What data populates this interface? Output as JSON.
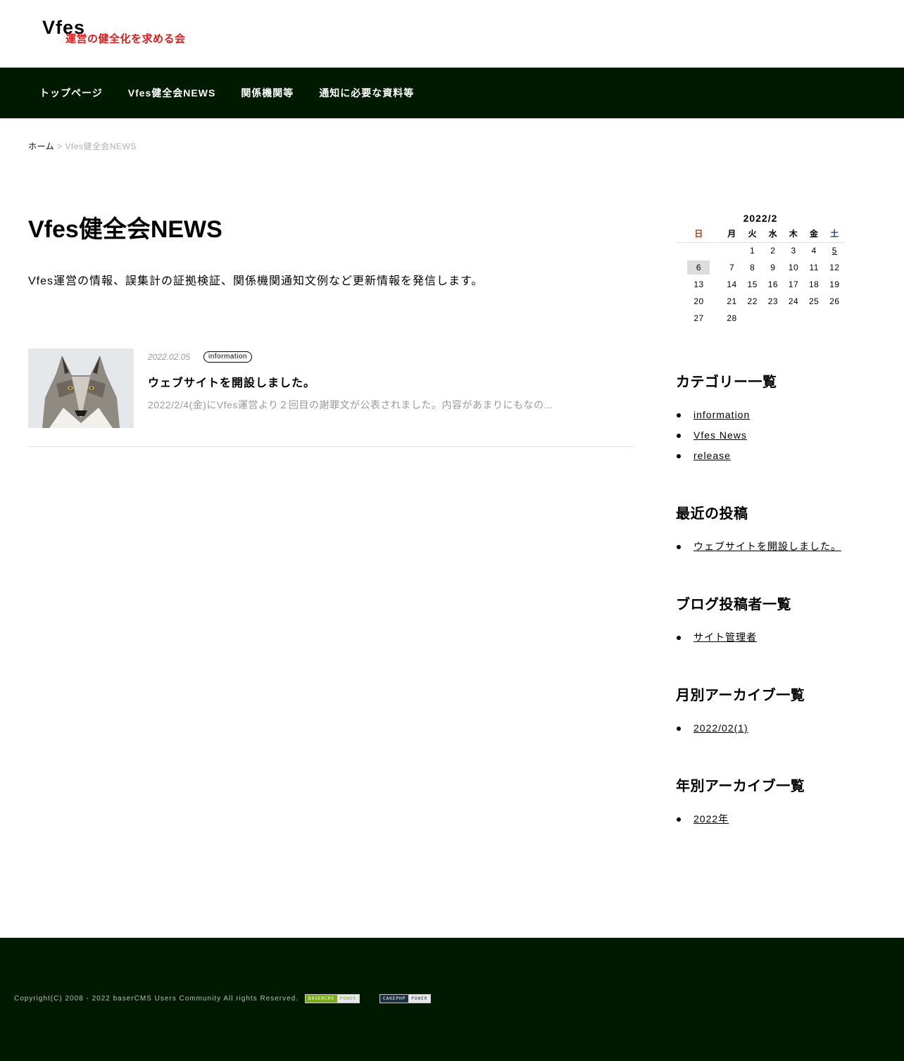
{
  "header": {
    "logo_main": "Vfes",
    "logo_sub": "運営の健全化を求める会"
  },
  "nav": {
    "items": [
      "トップページ",
      "Vfes健全会NEWS",
      "関係機関等",
      "通知に必要な資料等"
    ]
  },
  "breadcrumb": {
    "home": "ホーム",
    "separator": ">",
    "current": "Vfes健全会NEWS"
  },
  "main": {
    "title": "Vfes健全会NEWS",
    "description": "Vfes運営の情報、誤集計の証拠検証、関係機関通知文例など更新情報を発信します。",
    "post": {
      "date": "2022.02.05",
      "category": "information",
      "title": "ウェブサイトを開設しました。",
      "excerpt": "2022/2/4(金)にVfes運営より２回目の謝罪文が公表されました。内容があまりにもなの..."
    }
  },
  "sidebar": {
    "calendar": {
      "caption": "2022/2",
      "weekdays": [
        "日",
        "月",
        "火",
        "水",
        "木",
        "金",
        "土"
      ],
      "weeks": [
        [
          "",
          "",
          "1",
          "2",
          "3",
          "4",
          "5"
        ],
        [
          "6",
          "7",
          "8",
          "9",
          "10",
          "11",
          "12"
        ],
        [
          "13",
          "14",
          "15",
          "16",
          "17",
          "18",
          "19"
        ],
        [
          "20",
          "21",
          "22",
          "23",
          "24",
          "25",
          "26"
        ],
        [
          "27",
          "28",
          "",
          "",
          "",
          "",
          ""
        ]
      ],
      "today": "6",
      "linked_day": "5"
    },
    "categories": {
      "title": "カテゴリー一覧",
      "items": [
        "information",
        "Vfes News",
        "release"
      ]
    },
    "recent": {
      "title": "最近の投稿",
      "items": [
        "ウェブサイトを開設しました。"
      ]
    },
    "authors": {
      "title": "ブログ投稿者一覧",
      "items": [
        "サイト管理者"
      ]
    },
    "monthly": {
      "title": "月別アーカイブ一覧",
      "items": [
        "2022/02(1)"
      ]
    },
    "yearly": {
      "title": "年別アーカイブ一覧",
      "items": [
        "2022年"
      ]
    }
  },
  "footer": {
    "copyright": "Copyright(C) 2008 - 2022 baserCMS Users Community All rights Reserved.",
    "badge_basercms": [
      "BASERCMS",
      "POWER"
    ],
    "badge_cakephp": [
      "CAKEPHP",
      "POWER"
    ]
  }
}
